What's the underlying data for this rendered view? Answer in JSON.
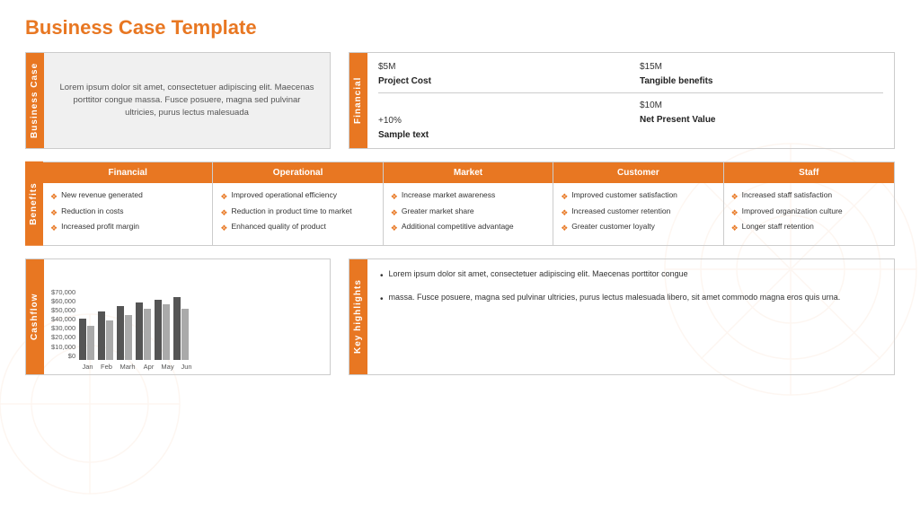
{
  "page": {
    "title": "Business Case Template",
    "background_color": "#fff",
    "accent_color": "#e87722"
  },
  "business_case": {
    "label": "Business Case",
    "text": "Lorem ipsum dolor sit amet, consectetuer adipiscing elit. Maecenas porttitor congue massa. Fusce posuere, magna sed pulvinar ultricies, purus lectus malesuada"
  },
  "financial_section": {
    "label": "Financial",
    "rows": [
      {
        "col1_val": "$5M",
        "col2_val": "$15M"
      },
      {
        "col1_label": "Project Cost",
        "col2_label": "Tangible benefits"
      },
      {
        "divider": true
      },
      {
        "col1_val": "$10M",
        "col2_val": "+10%"
      },
      {
        "col1_label": "Net Present Value",
        "col2_label": "Sample text"
      }
    ]
  },
  "benefits": {
    "label": "Benefits",
    "columns": [
      {
        "header": "Financial",
        "items": [
          "New revenue generated",
          "Reduction in costs",
          "Increased profit margin"
        ]
      },
      {
        "header": "Operational",
        "items": [
          "Improved operational efficiency",
          "Reduction in product time to market",
          "Enhanced quality of product"
        ]
      },
      {
        "header": "Market",
        "items": [
          "Increase market awareness",
          "Greater market share",
          "Additional competitive advantage"
        ]
      },
      {
        "header": "Customer",
        "items": [
          "Improved customer satisfaction",
          "Increased customer retention",
          "Greater customer loyalty"
        ]
      },
      {
        "header": "Staff",
        "items": [
          "Increased staff satisfaction",
          "Improved organization culture",
          "Longer staff retention"
        ]
      }
    ]
  },
  "cashflow": {
    "label": "Cashflow",
    "y_axis": [
      "$70,000",
      "$60,000",
      "$50,000",
      "$40,000",
      "$30,000",
      "$20,000",
      "$10,000",
      "$0"
    ],
    "x_labels": [
      "Jan",
      "Feb",
      "Mar h",
      "Apr",
      "May",
      "Jun"
    ],
    "bars": [
      {
        "dark": 45,
        "light": 38
      },
      {
        "dark": 52,
        "light": 42
      },
      {
        "dark": 58,
        "light": 48
      },
      {
        "dark": 62,
        "light": 55
      },
      {
        "dark": 65,
        "light": 60
      },
      {
        "dark": 68,
        "light": 55
      }
    ]
  },
  "key_highlights": {
    "label": "Key highlights",
    "items": [
      "Lorem ipsum dolor sit amet, consectetuer adipiscing elit. Maecenas porttitor congue",
      "massa. Fusce posuere, magna sed pulvinar ultricies, purus lectus malesuada libero, sit amet commodo magna eros quis urna."
    ]
  }
}
